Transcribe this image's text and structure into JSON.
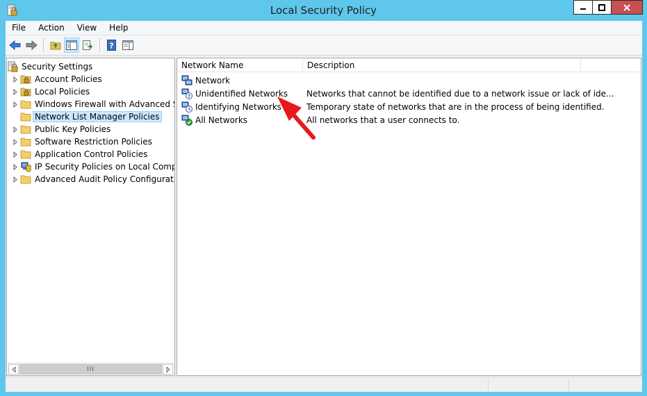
{
  "window": {
    "title": "Local Security Policy"
  },
  "menu": [
    "File",
    "Action",
    "View",
    "Help"
  ],
  "toolbar": [
    "back-icon",
    "forward-icon",
    "up-folder-icon",
    "show-hide-tree-icon",
    "export-list-icon",
    "help-icon",
    "console-view-icon"
  ],
  "tree": {
    "root": "Security Settings",
    "items": [
      {
        "label": "Account Policies",
        "icon": "lock-folder-icon",
        "expandable": true
      },
      {
        "label": "Local Policies",
        "icon": "lock-folder-icon",
        "expandable": true
      },
      {
        "label": "Windows Firewall with Advanced Secu",
        "icon": "folder-icon",
        "expandable": true
      },
      {
        "label": "Network List Manager Policies",
        "icon": "folder-icon",
        "expandable": false,
        "selected": true
      },
      {
        "label": "Public Key Policies",
        "icon": "folder-icon",
        "expandable": true
      },
      {
        "label": "Software Restriction Policies",
        "icon": "folder-icon",
        "expandable": true
      },
      {
        "label": "Application Control Policies",
        "icon": "folder-icon",
        "expandable": true
      },
      {
        "label": "IP Security Policies on Local Compute",
        "icon": "ip-security-icon",
        "expandable": true
      },
      {
        "label": "Advanced Audit Policy Configuration",
        "icon": "folder-icon",
        "expandable": true
      }
    ]
  },
  "scrollbar": {
    "thumb_grip": "III"
  },
  "list": {
    "columns": [
      "Network Name",
      "Description"
    ],
    "rows": [
      {
        "name": "Network",
        "description": "",
        "icon": "network-icon"
      },
      {
        "name": "Unidentified Networks",
        "description": "Networks that cannot be identified due to a network issue or lack of ide...",
        "icon": "network-unidentified-icon"
      },
      {
        "name": "Identifying Networks",
        "description": "Temporary state of networks that are in the process of being identified.",
        "icon": "network-identifying-icon"
      },
      {
        "name": "All Networks",
        "description": "All networks that a user connects to.",
        "icon": "network-all-icon"
      }
    ]
  },
  "colors": {
    "titlebar": "#5fc6ec",
    "selection": "#cce8ff",
    "close": "#c75050",
    "annotation": "#e8191c"
  }
}
